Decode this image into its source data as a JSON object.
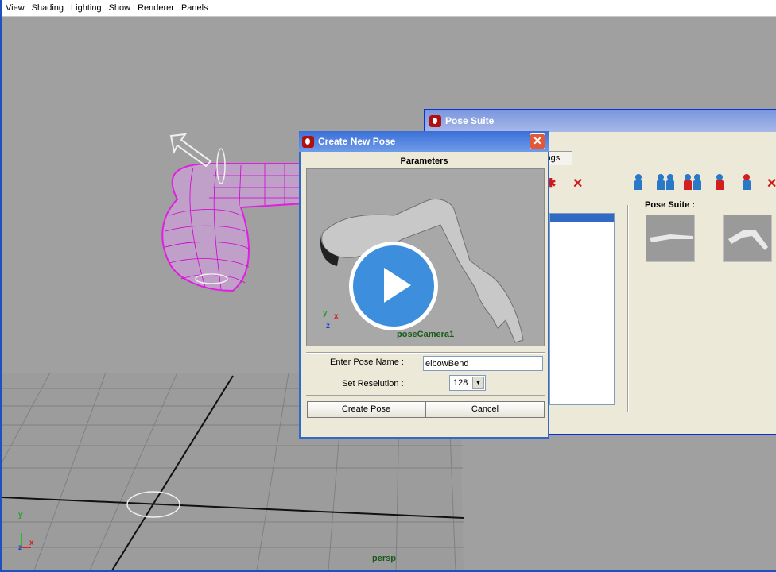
{
  "menubar": {
    "items": [
      "View",
      "Shading",
      "Lighting",
      "Show",
      "Renderer",
      "Panels"
    ]
  },
  "viewport": {
    "camera_label": "persp",
    "axis_labels": {
      "x": "x",
      "y": "y",
      "z": "z"
    }
  },
  "pose_suite": {
    "title": "Pose Suite",
    "tab_label": "ttings",
    "poses_label": "Pose Suite  :",
    "toolbar_icons": [
      "pose-red-x-icon",
      "delete-pose-icon",
      "figure-icon",
      "mirror-figure-icon",
      "pair-figure-icon",
      "flip-pose-icon",
      "swap-pose-icon",
      "close-pose-icon"
    ]
  },
  "dialog": {
    "title": "Create New Pose",
    "close_label": "✕",
    "section_label": "Parameters",
    "camera_label": "poseCamera1",
    "pose_name_label": "Enter Pose Name :",
    "pose_name_value": "elbowBend",
    "resolution_label": "Set Reselution :",
    "resolution_value": "128",
    "create_label": "Create Pose",
    "cancel_label": "Cancel"
  },
  "colors": {
    "titlebar_active": "#3a6fd8",
    "titlebar_inactive": "#7a96df",
    "mesh": "#e020e0",
    "play": "#3d8fde"
  }
}
